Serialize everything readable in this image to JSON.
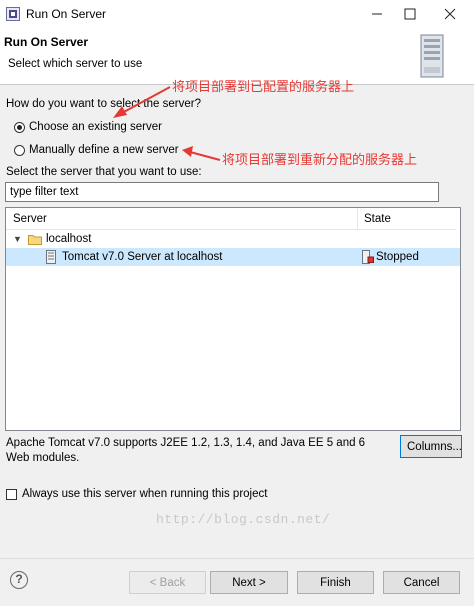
{
  "window": {
    "title": "Run On Server",
    "minimize_glyph": "—",
    "maximize_glyph": "☐",
    "close_glyph": "✕"
  },
  "header": {
    "title": "Run On Server",
    "subtitle": "Select which server to use",
    "image_icon": "server-wizard-icon"
  },
  "selection": {
    "prompt": "How do you want to select the server?",
    "options": [
      {
        "label": "Choose an existing server",
        "checked": true
      },
      {
        "label": "Manually define a new server",
        "checked": false
      }
    ]
  },
  "annotations": {
    "existing": "将项目部署到已配置的服务器上",
    "manual": "将项目部署到重新分配的服务器上",
    "color": "#e53935"
  },
  "filter": {
    "label": "Select the server that you want to use:",
    "value": "type filter text"
  },
  "table": {
    "columns": [
      "Server",
      "State"
    ],
    "host": {
      "label": "localhost",
      "expand_glyph": "▼"
    },
    "rows": [
      {
        "server": "Tomcat v7.0 Server at localhost",
        "state": "Stopped"
      }
    ],
    "selected_row_color": "#cce8ff"
  },
  "watermark": "http://blog.csdn.net/",
  "description": "Apache Tomcat v7.0 supports J2EE 1.2, 1.3, 1.4, and Java EE 5 and 6 Web modules.",
  "columns_button": "Columns...",
  "always_use": {
    "label": "Always use this server when running this project",
    "checked": false
  },
  "buttons": {
    "help": "?",
    "back": "< Back",
    "next": "Next >",
    "finish": "Finish",
    "cancel": "Cancel"
  }
}
